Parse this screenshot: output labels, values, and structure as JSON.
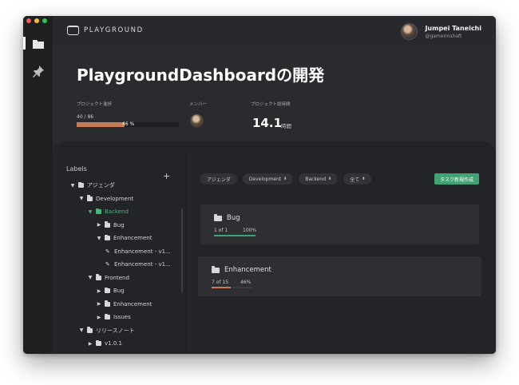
{
  "colors": {
    "accent": "#3fa373",
    "progress": "#c77b55",
    "selected": "#49b47e",
    "background": "#28292c"
  },
  "app": {
    "logo_text": "PLAYGROUND"
  },
  "rail": {
    "items": [
      {
        "icon": "folder-icon",
        "active": true
      },
      {
        "icon": "pin-icon",
        "active": false
      }
    ]
  },
  "user": {
    "name": "Jumpei Taneichi",
    "handle": "@gamerinshaft"
  },
  "project": {
    "title": "PlaygroundDashboardの開発",
    "progress_label": "プロジェクト進捗",
    "progress_count": "40 / 86",
    "progress_percent": "46 %",
    "progress_fraction": 0.465,
    "members_label": "メンバー",
    "hours_label": "プロジェクト総時間",
    "hours_value": "14.1",
    "hours_unit": "時間"
  },
  "sidebar": {
    "heading": "Labels",
    "add_symbol": "+",
    "tree": [
      {
        "label": "アジェンダ",
        "depth": 0,
        "expanded": true,
        "type": "folder"
      },
      {
        "label": "Development",
        "depth": 1,
        "expanded": true,
        "type": "folder"
      },
      {
        "label": "Backend",
        "depth": 2,
        "expanded": true,
        "type": "folder",
        "selected": true
      },
      {
        "label": "Bug",
        "depth": 3,
        "expanded": false,
        "type": "folder"
      },
      {
        "label": "Enhancement",
        "depth": 3,
        "expanded": true,
        "type": "folder"
      },
      {
        "label": "Enhancement - v1...",
        "depth": 4,
        "type": "item"
      },
      {
        "label": "Enhancement - v1...",
        "depth": 4,
        "type": "item"
      },
      {
        "label": "Frontend",
        "depth": 2,
        "expanded": true,
        "type": "folder"
      },
      {
        "label": "Bug",
        "depth": 3,
        "expanded": false,
        "type": "folder"
      },
      {
        "label": "Enhancement",
        "depth": 3,
        "expanded": false,
        "type": "folder"
      },
      {
        "label": "Issues",
        "depth": 3,
        "expanded": false,
        "type": "folder"
      },
      {
        "label": "リリースノート",
        "depth": 1,
        "expanded": true,
        "type": "folder"
      },
      {
        "label": "v1.0.1",
        "depth": 2,
        "expanded": false,
        "type": "folder"
      }
    ]
  },
  "filters": {
    "chips": [
      {
        "label": "アジェンダ",
        "sortable": false
      },
      {
        "label": "Development",
        "sortable": true
      },
      {
        "label": "Backend",
        "sortable": true
      },
      {
        "label": "全て",
        "sortable": true
      }
    ],
    "new_task_label": "タスク新規作成"
  },
  "cards": [
    {
      "title": "Bug",
      "count": "1 of 1",
      "percent": "100%",
      "fraction": 1.0,
      "color": "#3fa373"
    },
    {
      "title": "Enhancement",
      "count": "7 of 15",
      "percent": "46%",
      "fraction": 0.46,
      "color": "#c77b55"
    }
  ]
}
